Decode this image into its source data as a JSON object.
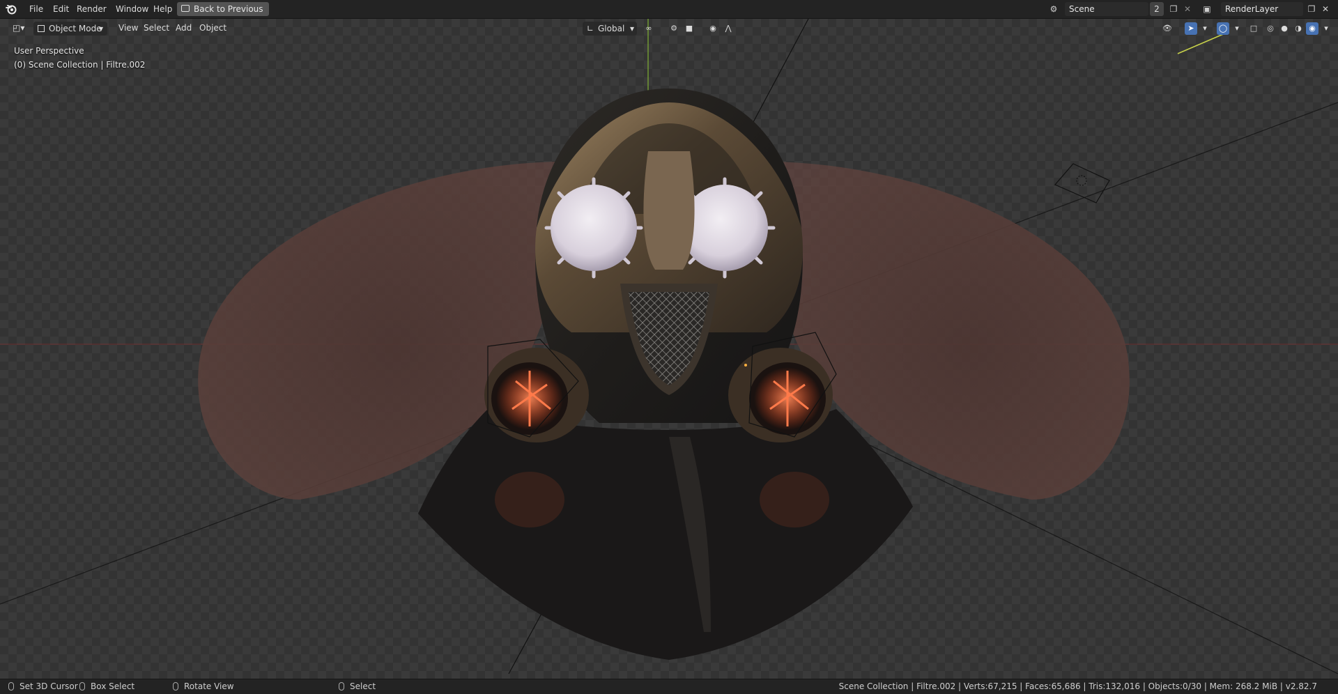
{
  "menu": {
    "items": [
      "File",
      "Edit",
      "Render",
      "Window",
      "Help"
    ],
    "back_button": "Back to Previous"
  },
  "scene": {
    "name": "Scene",
    "users": "2"
  },
  "render_layer": {
    "name": "RenderLayer"
  },
  "header": {
    "mode": "Object Mode",
    "menus": [
      "View",
      "Select",
      "Add",
      "Object"
    ],
    "transform_orientation": "Global"
  },
  "viewport": {
    "perspective": "User Perspective",
    "collection": "(0) Scene Collection | Filtre.002"
  },
  "status": {
    "hints": [
      "Set 3D Cursor",
      "Box Select",
      "Rotate View",
      "Select"
    ],
    "stats": "Scene Collection | Filtre.002 | Verts:67,215 | Faces:65,686 | Tris:132,016 | Objects:0/30 | Mem: 268.2 MiB | v2.82.7"
  },
  "icons": {
    "app": "blender-logo-icon",
    "editor_type": "3d-viewport-icon",
    "shading": [
      "wireframe-icon",
      "solid-icon",
      "material-preview-icon",
      "rendered-icon"
    ]
  },
  "colors": {
    "accent": "#4772b3",
    "background": "#1d1d1d",
    "x_axis": "#c0392b",
    "y_axis": "#7fb034"
  }
}
